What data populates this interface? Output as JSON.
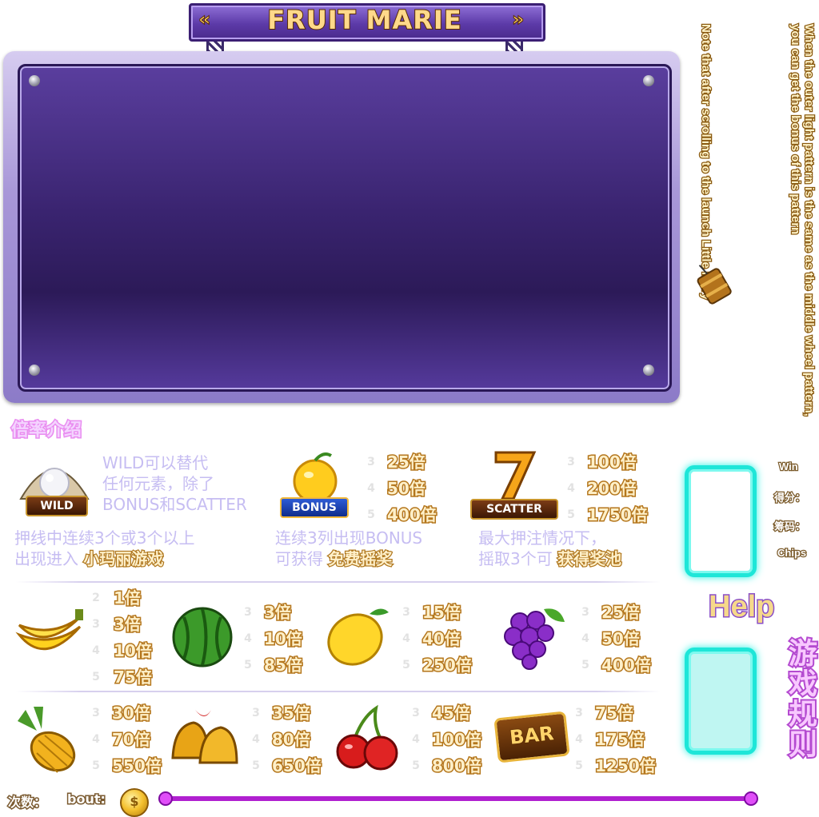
{
  "title": "FRUIT MARIE",
  "title_arrows": {
    "left": "«",
    "right": "»"
  },
  "notes": {
    "outer": "When the outer light pattern is the same as the middle wheel pattern, you can get the bonus of this pattern",
    "little_mary": "Note that after scrolling to the launch Little Mary"
  },
  "section_title": "倍率介绍",
  "specials": [
    {
      "icon": "pearl-icon",
      "badge": "WILD",
      "desc_lines": [
        "WILD可以替代",
        "任何元素，除了",
        "BONUS和SCATTER"
      ],
      "foot_lines": [
        "押线中连续3个或3个以上",
        "出现进入"
      ],
      "foot_highlight": "小玛丽游戏"
    },
    {
      "icon": "orange-icon",
      "badge": "BONUS",
      "counts": [
        "3",
        "4",
        "5"
      ],
      "multipliers": [
        "25倍",
        "50倍",
        "400倍"
      ],
      "foot_lines": [
        "连续3列出现BONUS",
        "可获得"
      ],
      "foot_highlight": "免费摇奖"
    },
    {
      "icon": "seven-icon",
      "badge": "SCATTER",
      "counts": [
        "3",
        "4",
        "5"
      ],
      "multipliers": [
        "100倍",
        "200倍",
        "1750倍"
      ],
      "foot_lines": [
        "最大押注情况下，",
        "摇取3个可"
      ],
      "foot_highlight": "获得奖池"
    }
  ],
  "fruits_row1": [
    {
      "icon": "banana-icon",
      "counts": [
        "2",
        "3",
        "4",
        "5"
      ],
      "multipliers": [
        "1倍",
        "3倍",
        "10倍",
        "75倍"
      ]
    },
    {
      "icon": "watermelon-icon",
      "counts": [
        "3",
        "4",
        "5"
      ],
      "multipliers": [
        "3倍",
        "10倍",
        "85倍"
      ]
    },
    {
      "icon": "lemon-icon",
      "counts": [
        "3",
        "4",
        "5"
      ],
      "multipliers": [
        "15倍",
        "40倍",
        "250倍"
      ]
    },
    {
      "icon": "grapes-icon",
      "counts": [
        "3",
        "4",
        "5"
      ],
      "multipliers": [
        "25倍",
        "50倍",
        "400倍"
      ]
    }
  ],
  "fruits_row2": [
    {
      "icon": "pineapple-icon",
      "counts": [
        "3",
        "4",
        "5"
      ],
      "multipliers": [
        "30倍",
        "70倍",
        "550倍"
      ]
    },
    {
      "icon": "bells-icon",
      "counts": [
        "3",
        "4",
        "5"
      ],
      "multipliers": [
        "35倍",
        "80倍",
        "650倍"
      ]
    },
    {
      "icon": "cherry-icon",
      "counts": [
        "3",
        "4",
        "5"
      ],
      "multipliers": [
        "45倍",
        "100倍",
        "800倍"
      ]
    },
    {
      "icon": "bar-icon",
      "bar_text": "BAR",
      "counts": [
        "3",
        "4",
        "5"
      ],
      "multipliers": [
        "75倍",
        "175倍",
        "1250倍"
      ]
    }
  ],
  "side": {
    "win": "Win",
    "score": "得分：",
    "chips_cn": "筹码：",
    "chips": "Chips",
    "help": "Help",
    "rules": "游戏规则"
  },
  "bottom": {
    "count_label": "次数：",
    "bout_label": "bout:",
    "coin_symbol": "$"
  },
  "colors": {
    "panel": "#3a2470",
    "accent_cyan": "#1ee6d8",
    "gold": "#f4c02e",
    "track": "#b020d0"
  }
}
